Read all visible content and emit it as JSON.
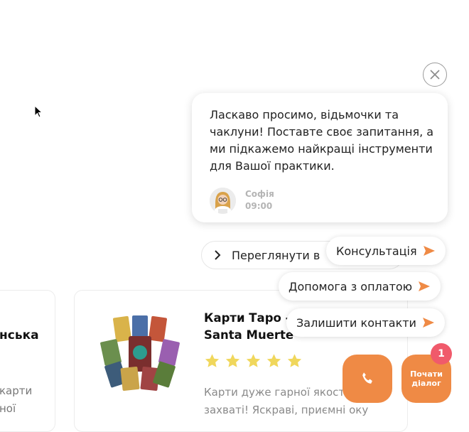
{
  "colors": {
    "accent": "#ef8a45",
    "badge": "#f05a6b",
    "star": "#f0d75c"
  },
  "products": {
    "view_all_label": "Переглянути в",
    "left_card": {
      "title_fragment": "нська",
      "desc_line1": "карти",
      "desc_line2": "ної"
    },
    "card": {
      "title": "Карти Таро - Смерті, Santa Muerte",
      "rating_stars": 5,
      "description": "Карти дуже гарної якості. Я в захваті! Яскраві, приємні оку"
    }
  },
  "chat": {
    "message": "Ласкаво просимо, відьмочки та чаклуни! Поставте своє запитання, а ми підкажемо найкращі інструменти для Вашої практики.",
    "agent_name": "Софія",
    "time": "09:00",
    "options": [
      "Консультація",
      "Допомога з оплатою",
      "Залишити контакти"
    ],
    "start_dialog_label": "Почати діалог",
    "badge_count": "1"
  }
}
